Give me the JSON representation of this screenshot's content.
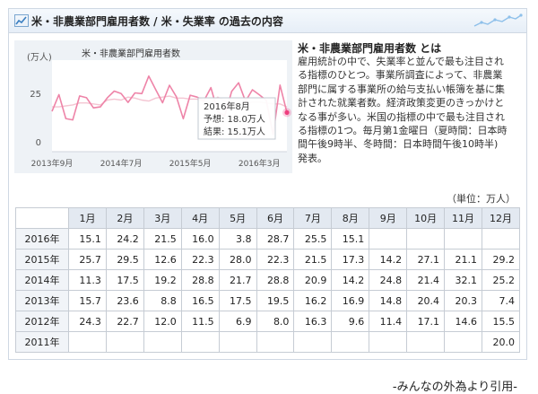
{
  "header": {
    "title": "米・非農業部門雇用者数 / 米・失業率 の過去の内容",
    "accent": "#3a7fc1"
  },
  "chart_data": {
    "type": "line",
    "title": "米・非農業部門雇用者数",
    "ylabel": "(万人)",
    "yticks": [
      "25",
      "0"
    ],
    "xticks": [
      "2013年9月",
      "2014年7月",
      "2015年5月",
      "2016年3月"
    ],
    "xtick_index": [
      0,
      10,
      20,
      30
    ],
    "ylim": [
      -5,
      42
    ],
    "grid": false,
    "legend": "none",
    "colors": {
      "forecast": "#f4c5d2",
      "actual": "#ee84a8",
      "highlight": "#ee3d7e"
    },
    "series": [
      {
        "name": "予想",
        "values": [
          18.0,
          18.0,
          18.5,
          19.0,
          20.0,
          20.0,
          19.5,
          19.0,
          21.5,
          22.0,
          21.5,
          23.0,
          22.5,
          21.5,
          21.0,
          22.5,
          23.0,
          23.5,
          22.5,
          22.5,
          22.0,
          22.0,
          20.5,
          20.0,
          23.0,
          21.0,
          19.0,
          20.0,
          19.5,
          20.5,
          20.5,
          20.0,
          19.5,
          19.5,
          18.0
        ]
      },
      {
        "name": "結果",
        "values": [
          15.7,
          24.3,
          12.0,
          11.3,
          23.6,
          22.7,
          17.5,
          18.0,
          22.6,
          26.1,
          24.8,
          20.3,
          25.2,
          24.8,
          33.8,
          26.9,
          20.1,
          29.1,
          23.2,
          11.9,
          24.0,
          23.0,
          21.2,
          27.9,
          15.5,
          13.4,
          26.0,
          30.4,
          20.9,
          26.8,
          24.2,
          21.4,
          3.8,
          29.2,
          15.1
        ]
      }
    ],
    "tooltip": {
      "month": "2016年8月",
      "forecast_label": "予想: 18.0万人",
      "result_label": "結果: 15.1万人",
      "index": 34,
      "forecast": 18.0,
      "actual": 15.1
    }
  },
  "description": {
    "title": "米・非農業部門雇用者数 とは",
    "lines": [
      "雇用統計の中で、失業率と並んで最も注目され",
      "る指標のひとつ。事業所調査によって、非農業",
      "部門に属する事業所の給与支払い帳簿を基に集",
      "計された就業者数。経済政策変更のきっかけと",
      "なる事が多い。米国の指標の中で最も注目され",
      "る指標の1つ。毎月第1金曜日（夏時間：日本時",
      "間午後9時半、冬時間：日本時間午後10時半)",
      "発表。"
    ]
  },
  "table": {
    "unit": "（単位：万人）",
    "columns": [
      "1月",
      "2月",
      "3月",
      "4月",
      "5月",
      "6月",
      "7月",
      "8月",
      "9月",
      "10月",
      "11月",
      "12月"
    ],
    "rows": [
      {
        "year": "2016年",
        "values": [
          "15.1",
          "24.2",
          "21.5",
          "16.0",
          "3.8",
          "28.7",
          "25.5",
          "15.1",
          "",
          "",
          "",
          ""
        ]
      },
      {
        "year": "2015年",
        "values": [
          "25.7",
          "29.5",
          "12.6",
          "22.3",
          "28.0",
          "22.3",
          "21.5",
          "17.3",
          "14.2",
          "27.1",
          "21.1",
          "29.2"
        ]
      },
      {
        "year": "2014年",
        "values": [
          "11.3",
          "17.5",
          "19.2",
          "28.8",
          "21.7",
          "28.8",
          "20.9",
          "14.2",
          "24.8",
          "21.4",
          "32.1",
          "25.2"
        ]
      },
      {
        "year": "2013年",
        "values": [
          "15.7",
          "23.6",
          "8.8",
          "16.5",
          "17.5",
          "19.5",
          "16.2",
          "16.9",
          "14.8",
          "20.4",
          "20.3",
          "7.4"
        ]
      },
      {
        "year": "2012年",
        "values": [
          "24.3",
          "22.7",
          "12.0",
          "11.5",
          "6.9",
          "8.0",
          "16.3",
          "9.6",
          "11.4",
          "17.1",
          "14.6",
          "15.5"
        ]
      },
      {
        "year": "2011年",
        "values": [
          "",
          "",
          "",
          "",
          "",
          "",
          "",
          "",
          "",
          "",
          "",
          "20.0"
        ]
      }
    ]
  },
  "footer": "-みんなの外為より引用-"
}
